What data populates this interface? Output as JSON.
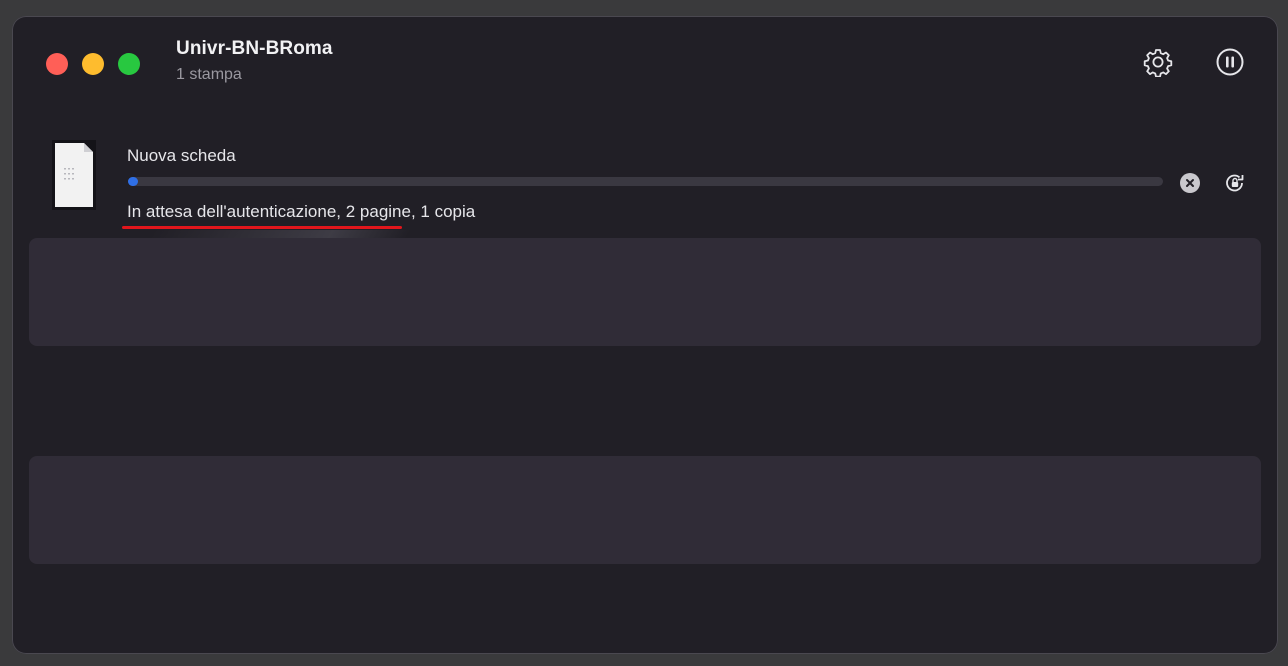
{
  "window": {
    "title": "Univr-BN-BRoma",
    "subtitle": "1 stampa"
  },
  "toolbar": {
    "settings_icon": "gear-icon",
    "pause_icon": "pause-circle-icon"
  },
  "jobs": [
    {
      "name": "Nuova scheda",
      "status": "In attesa dell'autenticazione, 2 pagine, 1 copia",
      "progress": 0.01,
      "icons": {
        "document": "document-icon",
        "cancel": "cancel-circle-icon",
        "resume": "lock-refresh-icon"
      }
    }
  ],
  "colors": {
    "window_bg": "#211f26",
    "row_bg": "#302c37",
    "progress": "#2f6fe6",
    "annotation": "#e1161c",
    "close": "#ff5f57",
    "minimize": "#febc2e",
    "zoom": "#28c840"
  }
}
